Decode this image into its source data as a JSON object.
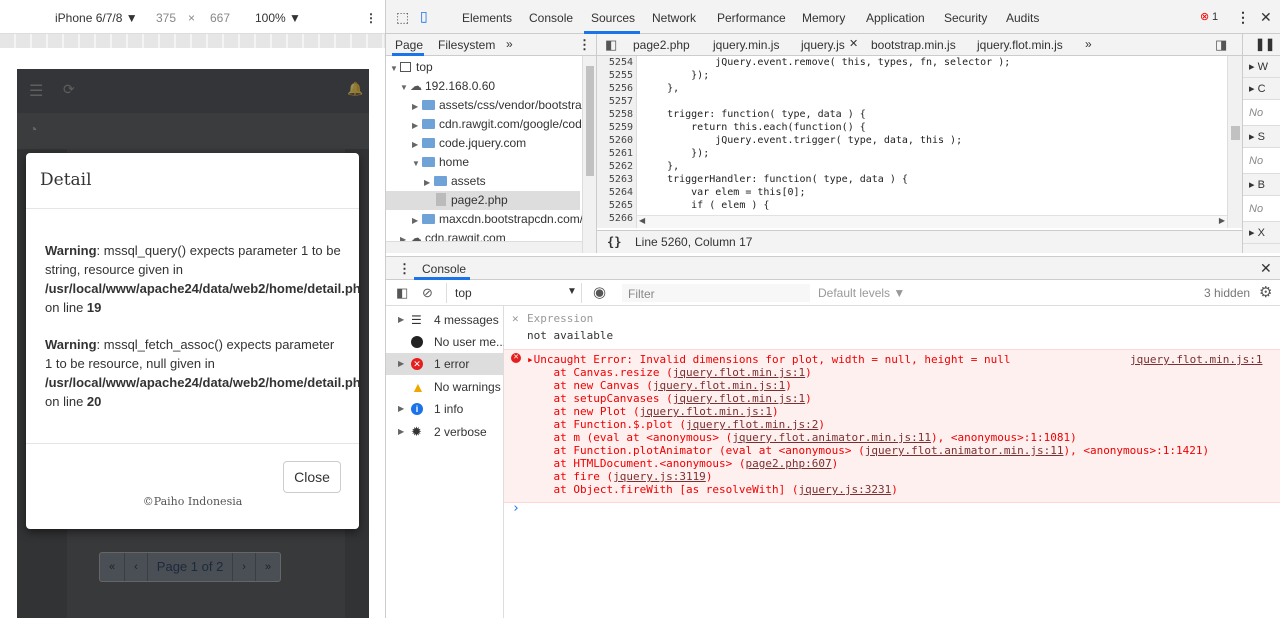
{
  "device_toolbar": {
    "device": "iPhone 6/7/8 ▼",
    "width": "375",
    "times": "×",
    "height": "667",
    "zoom": "100% ▼",
    "menu_icon": "more-vertical-icon"
  },
  "modal": {
    "title": "Detail",
    "warning1": {
      "label": "Warning",
      "text": ": mssql_query() expects parameter 1 to be",
      "text2": "string, resource given in",
      "path": "/usr/local/www/apache24/data/web2/home/detail.php",
      "line_prefix": "on line ",
      "line": "19"
    },
    "warning2": {
      "label": "Warning",
      "text": ": mssql_fetch_assoc() expects parameter",
      "text2": "1 to be resource, null given in",
      "path": "/usr/local/www/apache24/data/web2/home/detail.php",
      "line_prefix": "on line ",
      "line": "20"
    },
    "close_label": "Close",
    "footer": "©Paiho Indonesia"
  },
  "pager": {
    "first": "«",
    "prev": "‹",
    "page": "Page 1 of 2",
    "next": "›",
    "last": "»"
  },
  "devtools": {
    "tabs": [
      "Elements",
      "Console",
      "Sources",
      "Network",
      "Performance",
      "Memory",
      "Application",
      "Security",
      "Audits"
    ],
    "active_tab": "Sources",
    "error_count": "1",
    "nav_tabs": {
      "page": "Page",
      "filesystem": "Filesystem",
      "more": "»"
    },
    "tree": [
      {
        "label": "top"
      },
      {
        "label": "192.168.0.60"
      },
      {
        "label": "assets/css/vendor/bootstrap"
      },
      {
        "label": "cdn.rawgit.com/google/code"
      },
      {
        "label": "code.jquery.com"
      },
      {
        "label": "home"
      },
      {
        "label": "assets"
      },
      {
        "label": "page2.php"
      },
      {
        "label": "maxcdn.bootstrapcdn.com/"
      },
      {
        "label": "cdn.rawgit.com"
      }
    ],
    "editor_tabs": [
      "page2.php",
      "jquery.min.js",
      "jquery.js",
      "bootstrap.min.js",
      "jquery.flot.min.js"
    ],
    "active_editor_tab": "jquery.js",
    "editor_tabs_more": "»",
    "code": [
      {
        "n": "5254",
        "t": "            jQuery.event.remove( this, types, fn, selector );"
      },
      {
        "n": "5255",
        "t": "        });"
      },
      {
        "n": "5256",
        "t": "    },"
      },
      {
        "n": "5257",
        "t": ""
      },
      {
        "n": "5258",
        "t": "    trigger: function( type, data ) {"
      },
      {
        "n": "5259",
        "t": "        return this.each(function() {"
      },
      {
        "n": "5260",
        "t": "            jQuery.event.trigger( type, data, this );"
      },
      {
        "n": "5261",
        "t": "        });"
      },
      {
        "n": "5262",
        "t": "    },"
      },
      {
        "n": "5263",
        "t": "    triggerHandler: function( type, data ) {"
      },
      {
        "n": "5264",
        "t": "        var elem = this[0];"
      },
      {
        "n": "5265",
        "t": "        if ( elem ) {"
      },
      {
        "n": "5266",
        "t": ""
      }
    ],
    "status_braces": "{}",
    "status": "Line 5260, Column 17",
    "right_panel": [
      {
        "label": "▸ W",
        "italic": false
      },
      {
        "label": "▸ C",
        "italic": false
      },
      {
        "label": "No",
        "italic": true
      },
      {
        "label": "▸ S",
        "italic": false
      },
      {
        "label": "No",
        "italic": true
      },
      {
        "label": "▸ B",
        "italic": false
      },
      {
        "label": "No",
        "italic": true
      },
      {
        "label": "▸ X",
        "italic": false
      }
    ],
    "drawer_title": "Console",
    "console_toolbar": {
      "context": "top",
      "filter_placeholder": "Filter",
      "levels": "Default levels ▼",
      "hidden": "3 hidden"
    },
    "sidebar": [
      {
        "label": "4 messages",
        "icon": "list-icon"
      },
      {
        "label": "No user me...",
        "icon": "user-icon"
      },
      {
        "label": "1 error",
        "icon": "error-icon"
      },
      {
        "label": "No warnings",
        "icon": "warning-icon"
      },
      {
        "label": "1 info",
        "icon": "info-icon"
      },
      {
        "label": "2 verbose",
        "icon": "bug-icon"
      }
    ],
    "expression": {
      "label": "Expression",
      "value": "not available"
    },
    "error": {
      "message": "▸Uncaught Error: Invalid dimensions for plot, width = null, height = null",
      "source": "jquery.flot.min.js:1",
      "stack": [
        {
          "pre": "    at Canvas.resize (",
          "link": "jquery.flot.min.js:1",
          "post": ")"
        },
        {
          "pre": "    at new Canvas (",
          "link": "jquery.flot.min.js:1",
          "post": ")"
        },
        {
          "pre": "    at setupCanvases (",
          "link": "jquery.flot.min.js:1",
          "post": ")"
        },
        {
          "pre": "    at new Plot (",
          "link": "jquery.flot.min.js:1",
          "post": ")"
        },
        {
          "pre": "    at Function.$.plot (",
          "link": "jquery.flot.min.js:2",
          "post": ")"
        },
        {
          "pre": "    at m (eval at <anonymous> (",
          "link": "jquery.flot.animator.min.js:11",
          "post": "), <anonymous>:1:1081)"
        },
        {
          "pre": "    at Function.plotAnimator (eval at <anonymous> (",
          "link": "jquery.flot.animator.min.js:11",
          "post": "), <anonymous>:1:1421)"
        },
        {
          "pre": "    at HTMLDocument.<anonymous> (",
          "link": "page2.php:607",
          "post": ")"
        },
        {
          "pre": "    at fire (",
          "link": "jquery.js:3119",
          "post": ")"
        },
        {
          "pre": "    at Object.fireWith [as resolveWith] (",
          "link": "jquery.js:3231",
          "post": ")"
        }
      ]
    },
    "prompt": "›"
  }
}
